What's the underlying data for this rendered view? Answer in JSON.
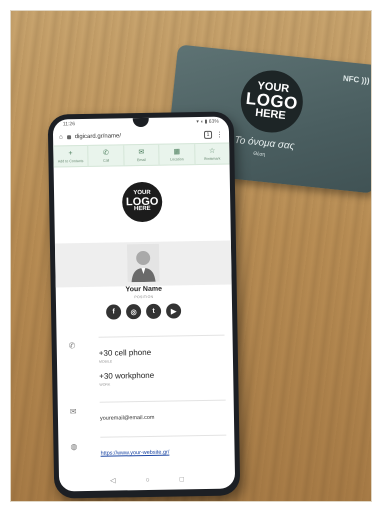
{
  "card": {
    "logo": {
      "line1": "YOUR",
      "line2": "LOGO",
      "line3": "HERE"
    },
    "nfc_label": "NFC",
    "name": "Το όνομα σας",
    "position": "Θέση"
  },
  "phone": {
    "status": {
      "time": "11:26",
      "icons": "▾ ◖ ▮ 63%"
    },
    "browser": {
      "url": "digicard.gr/name/",
      "tab_count": "1",
      "menu": "⋮"
    },
    "actions": [
      {
        "icon": "+",
        "label": "Add to Contacts"
      },
      {
        "icon": "✆",
        "label": "Call"
      },
      {
        "icon": "✉",
        "label": "Email"
      },
      {
        "icon": "▦",
        "label": "Location"
      },
      {
        "icon": "☆",
        "label": "Bookmark"
      }
    ],
    "brand_logo": {
      "line1": "YOUR",
      "line2": "LOGO",
      "line3": "HERE"
    },
    "profile": {
      "name": "Your Name",
      "position": "POSITION"
    },
    "socials": [
      {
        "icon": "facebook-icon",
        "glyph": "f"
      },
      {
        "icon": "instagram-icon",
        "glyph": "◎"
      },
      {
        "icon": "twitter-icon",
        "glyph": "t"
      },
      {
        "icon": "youtube-icon",
        "glyph": "▶"
      }
    ],
    "contact": {
      "phone_icon": "✆",
      "phones": [
        {
          "number": "+30 cell phone",
          "label": "MOBILE"
        },
        {
          "number": "+30 workphone",
          "label": "WORK"
        }
      ],
      "email_icon": "✉",
      "email": "youremail@email.com",
      "web_icon": "◍",
      "website": "https://www.your-website.gr/"
    },
    "nav": {
      "back": "◁",
      "home": "○",
      "recent": "□"
    }
  }
}
